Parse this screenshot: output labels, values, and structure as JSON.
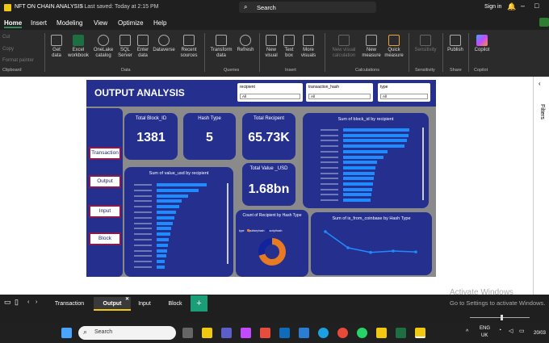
{
  "titlebar": {
    "file": "NFT ON CHAIN ANALYSIS",
    "saved": "• Last saved: Today at 2:15 PM",
    "search": "Search",
    "signin": "Sign in"
  },
  "menu": [
    "Home",
    "Insert",
    "Modeling",
    "View",
    "Optimize",
    "Help"
  ],
  "clipboard": {
    "cut": "Cut",
    "copy": "Copy",
    "format": "Format painter",
    "label": "Clipboard"
  },
  "ribbon": {
    "get_data": "Get data",
    "excel": "Excel workbook",
    "onelake": "OneLake catalog",
    "sql": "SQL Server",
    "enter": "Enter data",
    "dataverse": "Dataverse",
    "recent": "Recent sources",
    "data_label": "Data",
    "transform": "Transform data",
    "refresh": "Refresh",
    "queries_label": "Queries",
    "new_visual": "New visual",
    "text_box": "Text box",
    "more_visuals": "More visuals",
    "insert_label": "Insert",
    "new_visual_calc": "New visual calculation",
    "new_measure": "New measure",
    "quick_measure": "Quick measure",
    "calc_label": "Calculations",
    "sensitivity": "Sensitivity",
    "sensitivity_label": "Sensitivity",
    "publish": "Publish",
    "share_label": "Share",
    "copilot": "Copilot",
    "copilot_label": "Copilot"
  },
  "filters_label": "Filters",
  "report": {
    "title": "OUTPUT ANALYSIS",
    "slicers": [
      {
        "label": "recipient",
        "value": "All"
      },
      {
        "label": "transaction_hash",
        "value": "All"
      },
      {
        "label": "type",
        "value": "All"
      }
    ],
    "nav": [
      "Transaction",
      "Output",
      "Input",
      "Block"
    ],
    "kpis": [
      {
        "title": "Total Block_ID",
        "value": "1381"
      },
      {
        "title": "Hash Type",
        "value": "5"
      },
      {
        "title": "Total Recipent",
        "value": "65.73K"
      },
      {
        "title": "Total Value _USD",
        "value": "1.68bn"
      }
    ],
    "chart_titles": {
      "value_by_recipient": "Sum of value_usd by recipient",
      "block_by_recipient": "Sum of block_id by recipient",
      "recipient_by_type": "Count of Recipient by Hash Type",
      "coinbase_by_type": "Sum of is_from_coinbase by Hash Type"
    },
    "donut_legend": {
      "prefix": "type",
      "a": "pubkeyhash",
      "b": "scripthash"
    }
  },
  "chart_data": [
    {
      "type": "bar",
      "title": "Sum of value_usd by recipient",
      "values": [
        0.97,
        0.82,
        0.61,
        0.48,
        0.43,
        0.38,
        0.34,
        0.31,
        0.28,
        0.26,
        0.24,
        0.22,
        0.2,
        0.18,
        0.16,
        0.15
      ]
    },
    {
      "type": "bar",
      "title": "Sum of block_id by recipient",
      "values": [
        0.98,
        0.96,
        0.94,
        0.9,
        0.65,
        0.6,
        0.5,
        0.48,
        0.46,
        0.45,
        0.44,
        0.43,
        0.42,
        0.41
      ]
    },
    {
      "type": "pie",
      "title": "Count of Recipient by Hash Type",
      "values": [
        0.7,
        0.3
      ]
    },
    {
      "type": "line",
      "title": "Sum of is_from_coinbase by Hash Type",
      "values": [
        7,
        3.5,
        2.5,
        2.8,
        2.6
      ]
    }
  ],
  "tabs": [
    "Transaction",
    "Output",
    "Input",
    "Block"
  ],
  "active_tab": "Output",
  "watermark": {
    "line1": "Activate Windows",
    "line2": "Go to Settings to activate Windows."
  },
  "taskbar": {
    "search": "Search",
    "lang1": "ENG",
    "lang2": "UK",
    "date": "20/03"
  }
}
